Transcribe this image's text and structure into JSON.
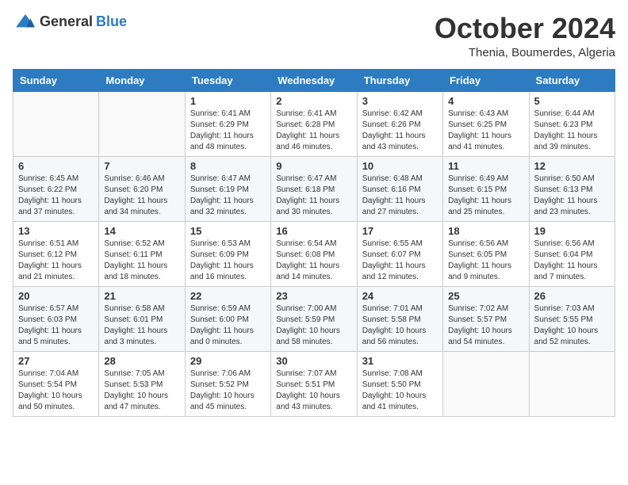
{
  "logo": {
    "general": "General",
    "blue": "Blue"
  },
  "header": {
    "month": "October 2024",
    "location": "Thenia, Boumerdes, Algeria"
  },
  "days_of_week": [
    "Sunday",
    "Monday",
    "Tuesday",
    "Wednesday",
    "Thursday",
    "Friday",
    "Saturday"
  ],
  "weeks": [
    [
      {
        "day": "",
        "info": ""
      },
      {
        "day": "",
        "info": ""
      },
      {
        "day": "1",
        "info": "Sunrise: 6:41 AM\nSunset: 6:29 PM\nDaylight: 11 hours and 48 minutes."
      },
      {
        "day": "2",
        "info": "Sunrise: 6:41 AM\nSunset: 6:28 PM\nDaylight: 11 hours and 46 minutes."
      },
      {
        "day": "3",
        "info": "Sunrise: 6:42 AM\nSunset: 6:26 PM\nDaylight: 11 hours and 43 minutes."
      },
      {
        "day": "4",
        "info": "Sunrise: 6:43 AM\nSunset: 6:25 PM\nDaylight: 11 hours and 41 minutes."
      },
      {
        "day": "5",
        "info": "Sunrise: 6:44 AM\nSunset: 6:23 PM\nDaylight: 11 hours and 39 minutes."
      }
    ],
    [
      {
        "day": "6",
        "info": "Sunrise: 6:45 AM\nSunset: 6:22 PM\nDaylight: 11 hours and 37 minutes."
      },
      {
        "day": "7",
        "info": "Sunrise: 6:46 AM\nSunset: 6:20 PM\nDaylight: 11 hours and 34 minutes."
      },
      {
        "day": "8",
        "info": "Sunrise: 6:47 AM\nSunset: 6:19 PM\nDaylight: 11 hours and 32 minutes."
      },
      {
        "day": "9",
        "info": "Sunrise: 6:47 AM\nSunset: 6:18 PM\nDaylight: 11 hours and 30 minutes."
      },
      {
        "day": "10",
        "info": "Sunrise: 6:48 AM\nSunset: 6:16 PM\nDaylight: 11 hours and 27 minutes."
      },
      {
        "day": "11",
        "info": "Sunrise: 6:49 AM\nSunset: 6:15 PM\nDaylight: 11 hours and 25 minutes."
      },
      {
        "day": "12",
        "info": "Sunrise: 6:50 AM\nSunset: 6:13 PM\nDaylight: 11 hours and 23 minutes."
      }
    ],
    [
      {
        "day": "13",
        "info": "Sunrise: 6:51 AM\nSunset: 6:12 PM\nDaylight: 11 hours and 21 minutes."
      },
      {
        "day": "14",
        "info": "Sunrise: 6:52 AM\nSunset: 6:11 PM\nDaylight: 11 hours and 18 minutes."
      },
      {
        "day": "15",
        "info": "Sunrise: 6:53 AM\nSunset: 6:09 PM\nDaylight: 11 hours and 16 minutes."
      },
      {
        "day": "16",
        "info": "Sunrise: 6:54 AM\nSunset: 6:08 PM\nDaylight: 11 hours and 14 minutes."
      },
      {
        "day": "17",
        "info": "Sunrise: 6:55 AM\nSunset: 6:07 PM\nDaylight: 11 hours and 12 minutes."
      },
      {
        "day": "18",
        "info": "Sunrise: 6:56 AM\nSunset: 6:05 PM\nDaylight: 11 hours and 9 minutes."
      },
      {
        "day": "19",
        "info": "Sunrise: 6:56 AM\nSunset: 6:04 PM\nDaylight: 11 hours and 7 minutes."
      }
    ],
    [
      {
        "day": "20",
        "info": "Sunrise: 6:57 AM\nSunset: 6:03 PM\nDaylight: 11 hours and 5 minutes."
      },
      {
        "day": "21",
        "info": "Sunrise: 6:58 AM\nSunset: 6:01 PM\nDaylight: 11 hours and 3 minutes."
      },
      {
        "day": "22",
        "info": "Sunrise: 6:59 AM\nSunset: 6:00 PM\nDaylight: 11 hours and 0 minutes."
      },
      {
        "day": "23",
        "info": "Sunrise: 7:00 AM\nSunset: 5:59 PM\nDaylight: 10 hours and 58 minutes."
      },
      {
        "day": "24",
        "info": "Sunrise: 7:01 AM\nSunset: 5:58 PM\nDaylight: 10 hours and 56 minutes."
      },
      {
        "day": "25",
        "info": "Sunrise: 7:02 AM\nSunset: 5:57 PM\nDaylight: 10 hours and 54 minutes."
      },
      {
        "day": "26",
        "info": "Sunrise: 7:03 AM\nSunset: 5:55 PM\nDaylight: 10 hours and 52 minutes."
      }
    ],
    [
      {
        "day": "27",
        "info": "Sunrise: 7:04 AM\nSunset: 5:54 PM\nDaylight: 10 hours and 50 minutes."
      },
      {
        "day": "28",
        "info": "Sunrise: 7:05 AM\nSunset: 5:53 PM\nDaylight: 10 hours and 47 minutes."
      },
      {
        "day": "29",
        "info": "Sunrise: 7:06 AM\nSunset: 5:52 PM\nDaylight: 10 hours and 45 minutes."
      },
      {
        "day": "30",
        "info": "Sunrise: 7:07 AM\nSunset: 5:51 PM\nDaylight: 10 hours and 43 minutes."
      },
      {
        "day": "31",
        "info": "Sunrise: 7:08 AM\nSunset: 5:50 PM\nDaylight: 10 hours and 41 minutes."
      },
      {
        "day": "",
        "info": ""
      },
      {
        "day": "",
        "info": ""
      }
    ]
  ]
}
